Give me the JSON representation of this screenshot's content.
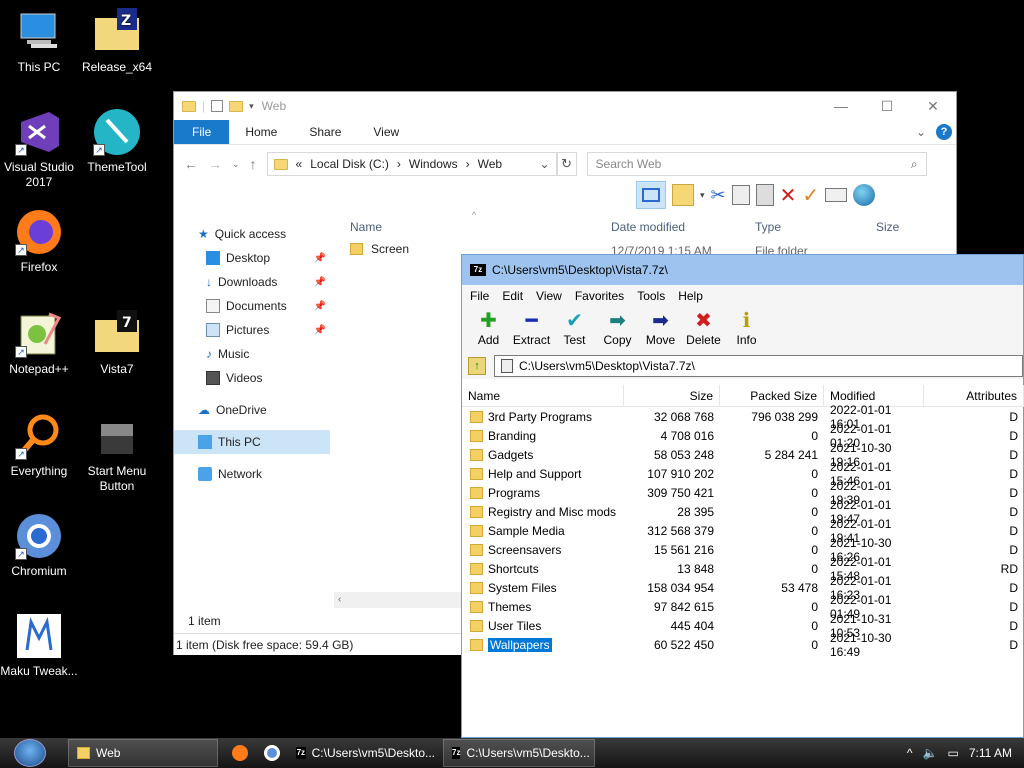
{
  "desktop": {
    "icons": [
      {
        "label": "This PC"
      },
      {
        "label": "Release_x64"
      },
      {
        "label": "Visual Studio 2017"
      },
      {
        "label": "ThemeTool"
      },
      {
        "label": "Firefox"
      },
      {
        "label": "Notepad++"
      },
      {
        "label": "Vista7"
      },
      {
        "label": "Everything"
      },
      {
        "label": "Start Menu Button"
      },
      {
        "label": "Chromium"
      },
      {
        "label": "Maku Tweak..."
      }
    ]
  },
  "explorer": {
    "title": "Web",
    "tabs": {
      "file": "File",
      "home": "Home",
      "share": "Share",
      "view": "View"
    },
    "address": {
      "root": "Local Disk (C:)",
      "p1": "Windows",
      "p2": "Web"
    },
    "search_placeholder": "Search Web",
    "columns": {
      "name": "Name",
      "date": "Date modified",
      "type": "Type",
      "size": "Size"
    },
    "files": [
      {
        "name": "Screen",
        "date": "12/7/2019 1:15 AM",
        "type": "File folder"
      }
    ],
    "nav": {
      "quick_access": "Quick access",
      "desktop": "Desktop",
      "downloads": "Downloads",
      "documents": "Documents",
      "pictures": "Pictures",
      "music": "Music",
      "videos": "Videos",
      "onedrive": "OneDrive",
      "thispc": "This PC",
      "network": "Network"
    },
    "status_count": "1 item",
    "status_disk": "1 item (Disk free space: 59.4 GB)"
  },
  "zip": {
    "title": "C:\\Users\\vm5\\Desktop\\Vista7.7z\\",
    "menu": [
      "File",
      "Edit",
      "View",
      "Favorites",
      "Tools",
      "Help"
    ],
    "tools": [
      "Add",
      "Extract",
      "Test",
      "Copy",
      "Move",
      "Delete",
      "Info"
    ],
    "path": "C:\\Users\\vm5\\Desktop\\Vista7.7z\\",
    "columns": {
      "name": "Name",
      "size": "Size",
      "packed": "Packed Size",
      "modified": "Modified",
      "attributes": "Attributes"
    },
    "rows": [
      {
        "name": "3rd Party Programs",
        "size": "32 068 768",
        "packed": "796 038 299",
        "modified": "2022-01-01 16:01",
        "attr": "D"
      },
      {
        "name": "Branding",
        "size": "4 708 016",
        "packed": "0",
        "modified": "2022-01-01 01:20",
        "attr": "D"
      },
      {
        "name": "Gadgets",
        "size": "58 053 248",
        "packed": "5 284 241",
        "modified": "2021-10-30 19:16",
        "attr": "D"
      },
      {
        "name": "Help and Support",
        "size": "107 910 202",
        "packed": "0",
        "modified": "2022-01-01 15:46",
        "attr": "D"
      },
      {
        "name": "Programs",
        "size": "309 750 421",
        "packed": "0",
        "modified": "2022-01-01 19:39",
        "attr": "D"
      },
      {
        "name": "Registry and Misc mods",
        "size": "28 395",
        "packed": "0",
        "modified": "2022-01-01 19:47",
        "attr": "D"
      },
      {
        "name": "Sample Media",
        "size": "312 568 379",
        "packed": "0",
        "modified": "2022-01-01 19:41",
        "attr": "D"
      },
      {
        "name": "Screensavers",
        "size": "15 561 216",
        "packed": "0",
        "modified": "2021-10-30 16:26",
        "attr": "D"
      },
      {
        "name": "Shortcuts",
        "size": "13 848",
        "packed": "0",
        "modified": "2022-01-01 15:48",
        "attr": "RD"
      },
      {
        "name": "System Files",
        "size": "158 034 954",
        "packed": "53 478",
        "modified": "2022-01-01 16:23",
        "attr": "D"
      },
      {
        "name": "Themes",
        "size": "97 842 615",
        "packed": "0",
        "modified": "2022-01-01 01:49",
        "attr": "D"
      },
      {
        "name": "User Tiles",
        "size": "445 404",
        "packed": "0",
        "modified": "2021-10-31 10:53",
        "attr": "D"
      },
      {
        "name": "Wallpapers",
        "size": "60 522 450",
        "packed": "0",
        "modified": "2021-10-30 16:49",
        "attr": "D"
      }
    ]
  },
  "taskbar": {
    "items": [
      "Web",
      "C:\\Users\\vm5\\Deskto...",
      "C:\\Users\\vm5\\Deskto..."
    ],
    "clock": "7:11 AM"
  }
}
